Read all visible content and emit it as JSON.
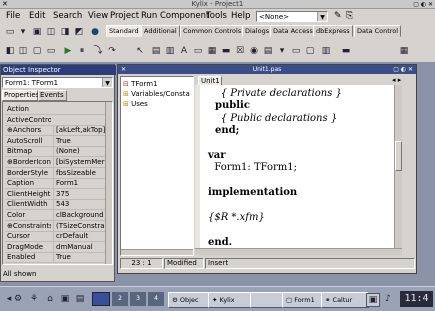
{
  "window": {
    "title": "Kylix - Project1"
  },
  "menu": [
    "File",
    "Edit",
    "Search",
    "View",
    "Project",
    "Run",
    "Component",
    "Tools",
    "Help"
  ],
  "desktop_combo": {
    "value": "<None>"
  },
  "palette_tabs": [
    "Standard",
    "Additional",
    "Common Controls",
    "Dialogs",
    "Data Access",
    "dbExpress",
    "Data Control"
  ],
  "object_inspector": {
    "title": "Object Inspector",
    "selected": "Form1: TForm1",
    "tabs": [
      "Properties",
      "Events"
    ],
    "rows": [
      {
        "name": "Action",
        "value": ""
      },
      {
        "name": "ActiveContro",
        "value": ""
      },
      {
        "name": "⊕Anchors",
        "value": "[akLeft,akTop]"
      },
      {
        "name": "AutoScroll",
        "value": "True"
      },
      {
        "name": "Bitmap",
        "value": "(None)"
      },
      {
        "name": "⊕BorderIcons",
        "value": "[biSystemMer"
      },
      {
        "name": "BorderStyle",
        "value": "fbsSizeable"
      },
      {
        "name": "Caption",
        "value": "Form1"
      },
      {
        "name": "ClientHeight",
        "value": "375"
      },
      {
        "name": "ClientWidth",
        "value": "543"
      },
      {
        "name": "Color",
        "value": "clBackground"
      },
      {
        "name": "⊕Constraints",
        "value": "(TSizeConstra"
      },
      {
        "name": "Cursor",
        "value": "crDefault"
      },
      {
        "name": "DragMode",
        "value": "dmManual"
      },
      {
        "name": "Enabled",
        "value": "True"
      }
    ],
    "status": "All shown"
  },
  "editor": {
    "title": "Unit1.pas",
    "tab": "Unit1",
    "tree": [
      "TForm1",
      "Variables/Consta",
      "Uses"
    ],
    "code_lines": [
      {
        "text": "    { Private declarations }",
        "style": "cm"
      },
      {
        "text": "  public",
        "style": "kw"
      },
      {
        "text": "    { Public declarations }",
        "style": "cm"
      },
      {
        "text": "  end;",
        "style": "kw"
      },
      {
        "text": "",
        "style": ""
      },
      {
        "text": "var",
        "style": "kw"
      },
      {
        "text": "  Form1: TForm1;",
        "style": ""
      },
      {
        "text": "",
        "style": ""
      },
      {
        "text": "implementation",
        "style": "kw"
      },
      {
        "text": "",
        "style": ""
      },
      {
        "text": "{$R *.xfm}",
        "style": "cm"
      },
      {
        "text": "",
        "style": ""
      },
      {
        "text": "end.",
        "style": "kw"
      }
    ],
    "status": {
      "position": "23 : 1",
      "state": "Modified",
      "mode": "Insert"
    }
  },
  "taskbar": {
    "pager": [
      "2",
      "3",
      "4"
    ],
    "tasks": [
      "Objec",
      "Kylix",
      "",
      "Form1",
      "Caltur"
    ],
    "clock": "11:4"
  }
}
